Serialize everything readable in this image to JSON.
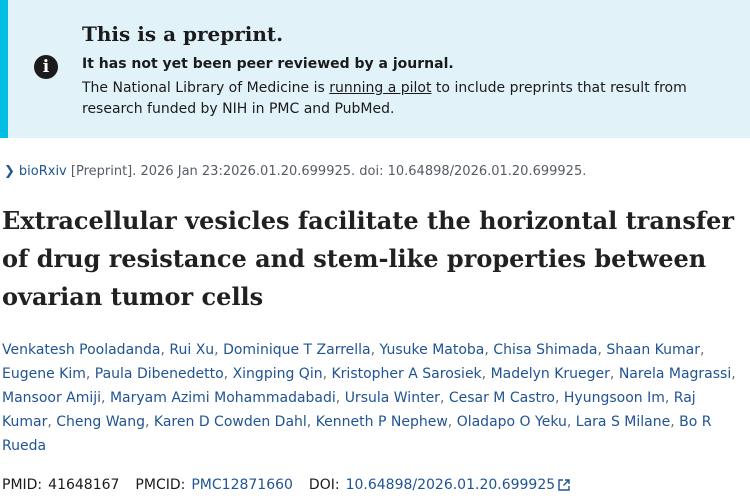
{
  "banner": {
    "title": "This is a preprint.",
    "strong": "It has not yet been peer reviewed by a journal.",
    "body_pre": "The National Library of Medicine is ",
    "body_link": "running a pilot",
    "body_post": " to include preprints that result from research funded by NIH in PMC and PubMed.",
    "icon": "info-icon",
    "accent_color": "#00bde3",
    "background_color": "#e1f3f8"
  },
  "citation": {
    "source": "bioRxiv",
    "text": " [Preprint]. 2026 Jan 23:2026.01.20.699925. doi: 10.64898/2026.01.20.699925."
  },
  "article": {
    "title": "Extracellular vesicles facilitate the horizontal transfer of drug resistance and stem-like properties between ovarian tumor cells",
    "authors": [
      "Venkatesh Pooladanda",
      "Rui Xu",
      "Dominique T Zarrella",
      "Yusuke Matoba",
      "Chisa Shimada",
      "Shaan Kumar",
      "Eugene Kim",
      "Paula Dibenedetto",
      "Xingping Qin",
      "Kristopher A Sarosiek",
      "Madelyn Krueger",
      "Narela Magrassi",
      "Mansoor Amiji",
      "Maryam Azimi Mohammadabadi",
      "Ursula Winter",
      "Cesar M Castro",
      "Hyungsoon Im",
      "Raj Kumar",
      "Cheng Wang",
      "Karen D Cowden Dahl",
      "Kenneth P Nephew",
      "Oladapo O Yeku",
      "Lara S Milane",
      "Bo R Rueda"
    ]
  },
  "identifiers": {
    "pmid_label": "PMID:",
    "pmid": "41648167",
    "pmcid_label": "PMCID:",
    "pmcid": "PMC12871660",
    "doi_label": "DOI:",
    "doi": "10.64898/2026.01.20.699925"
  },
  "colors": {
    "link": "#205493"
  }
}
